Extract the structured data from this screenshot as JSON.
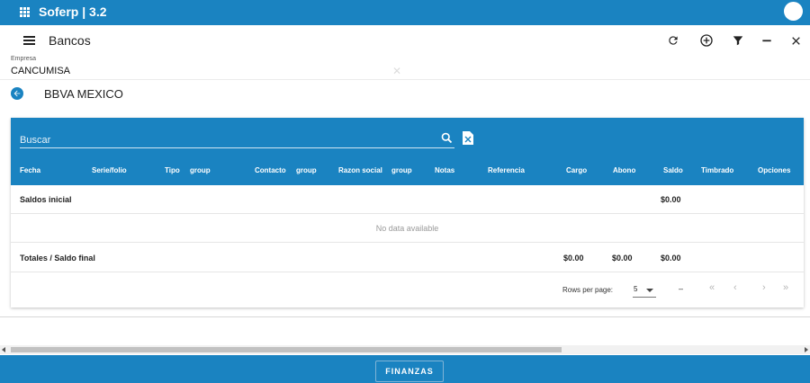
{
  "app": {
    "title": "Soferp | 3.2"
  },
  "toolbar": {
    "title": "Bancos"
  },
  "empresa": {
    "label": "Empresa",
    "value": "CANCUMISA"
  },
  "bank": {
    "title": "BBVA MEXICO"
  },
  "search": {
    "placeholder": "Buscar"
  },
  "table": {
    "headers": {
      "fecha": "Fecha",
      "serie": "Serie/folio",
      "tipo": "Tipo",
      "group1": "group",
      "contacto": "Contacto",
      "group2": "group",
      "razon": "Razon social",
      "group3": "group",
      "notas": "Notas",
      "referencia": "Referencia",
      "cargo": "Cargo",
      "abono": "Abono",
      "saldo": "Saldo",
      "timbrado": "Timbrado",
      "opciones": "Opciones"
    },
    "saldos_inicial": {
      "label": "Saldos inicial",
      "saldo": "$0.00"
    },
    "no_data": "No data available",
    "totales": {
      "label": "Totales / Saldo final",
      "cargo": "$0.00",
      "abono": "$0.00",
      "saldo": "$0.00"
    }
  },
  "pagination": {
    "rows_per_page_label": "Rows per page:",
    "rows_per_page_value": "5",
    "range": "–"
  },
  "footer": {
    "button_label": "FINANZAS"
  },
  "colors": {
    "primary": "#1a83c1"
  }
}
